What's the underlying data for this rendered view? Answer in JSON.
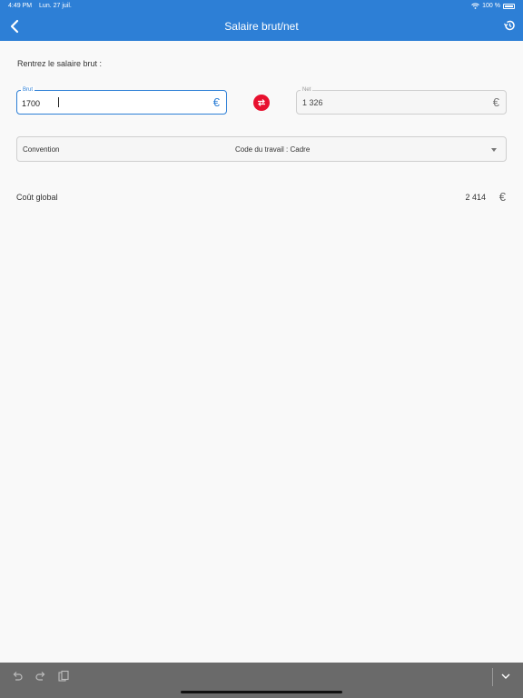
{
  "status_bar": {
    "time": "4:49 PM",
    "date": "Lun. 27 juil.",
    "battery": "100 %"
  },
  "header": {
    "title": "Salaire brut/net"
  },
  "prompt": "Rentrez le salaire brut :",
  "brut_field": {
    "label": "Brut",
    "value": "1700",
    "currency": "€"
  },
  "net_field": {
    "label": "Net",
    "value": "1 326",
    "currency": "€"
  },
  "convention": {
    "label": "Convention",
    "value": "Code du travail : Cadre"
  },
  "cost": {
    "label": "Coût global",
    "value": "2 414",
    "currency": "€"
  },
  "colors": {
    "accent": "#2d7fd6",
    "swap": "#e8112f",
    "keyboard_bar": "#6a6a6a"
  },
  "icons": [
    "back-chevron-icon",
    "history-icon",
    "swap-icon",
    "wifi-icon",
    "battery-icon",
    "undo-icon",
    "redo-icon",
    "clipboard-icon",
    "chevron-down-icon"
  ]
}
